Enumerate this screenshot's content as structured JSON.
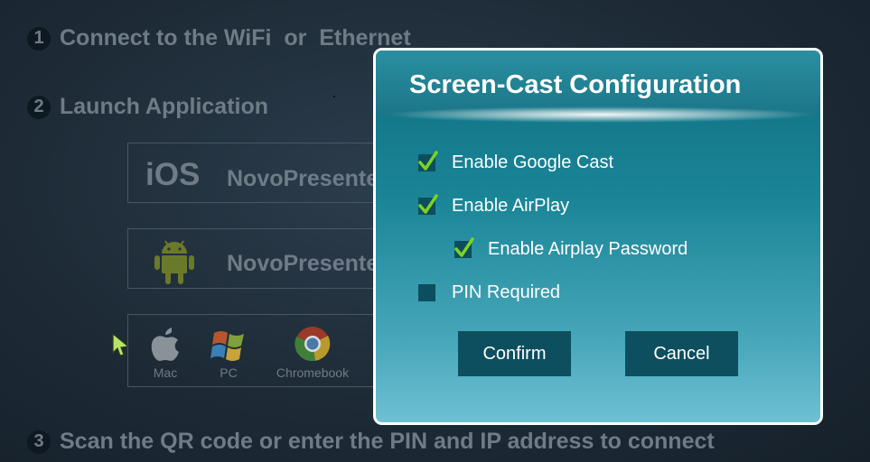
{
  "background": {
    "steps": [
      {
        "number": "1",
        "text": "Connect to the WiFi  or  Ethernet"
      },
      {
        "number": "2",
        "text": "Launch Application"
      },
      {
        "number": "3",
        "text": "Scan the QR code or enter the PIN and IP address to connect"
      }
    ],
    "apps": {
      "ios_label": "iOS",
      "ios_app_name": "NovoPresenter",
      "android_app_name": "NovoPresenter",
      "platforms": [
        {
          "label": "Mac",
          "icon": "apple-icon"
        },
        {
          "label": "PC",
          "icon": "windows-icon"
        },
        {
          "label": "Chromebook",
          "icon": "chrome-icon"
        }
      ]
    }
  },
  "dialog": {
    "title": "Screen-Cast Configuration",
    "options": [
      {
        "label": "Enable Google Cast",
        "checked": true
      },
      {
        "label": "Enable AirPlay",
        "checked": true
      },
      {
        "label": "Enable Airplay Password",
        "checked": true
      },
      {
        "label": "PIN Required",
        "checked": false
      }
    ],
    "confirm_label": "Confirm",
    "cancel_label": "Cancel"
  },
  "colors": {
    "accent": "#1a8597",
    "check": "#7ed321",
    "button": "#0d4f5f"
  }
}
